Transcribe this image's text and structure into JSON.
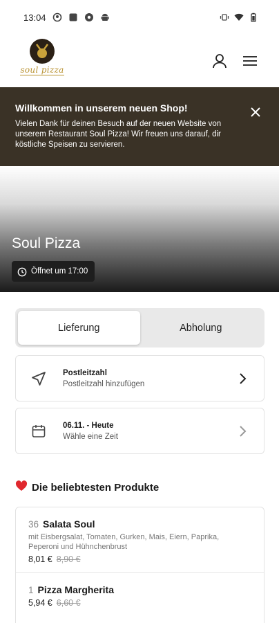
{
  "status_bar": {
    "time": "13:04"
  },
  "logo": {
    "text": "soul pizza"
  },
  "banner": {
    "title": "Willkommen in unserem neuen Shop!",
    "text": "Vielen Dank für deinen Besuch auf der neuen Website von unserem Restaurant Soul Pizza! Wir freuen uns darauf, dir köstliche Speisen zu servieren."
  },
  "hero": {
    "title": "Soul Pizza",
    "badge": "Öffnet um 17:00"
  },
  "delivery_toggle": {
    "options": [
      "Lieferung",
      "Abholung"
    ],
    "selected": "Lieferung"
  },
  "postcode_card": {
    "title": "Postleitzahl",
    "subtitle": "Postleitzahl hinzufügen"
  },
  "date_card": {
    "title": "06.11. - Heute",
    "subtitle": "Wähle eine Zeit"
  },
  "popular": {
    "title": "Die beliebtesten Produkte",
    "products": [
      {
        "number": "36",
        "name": "Salata Soul",
        "description": "mit Eisbergsalat, Tomaten, Gurken, Mais, Eiern, Paprika, Peperoni und Hühnchenbrust",
        "price": "8,01 €",
        "old_price": "8,90 €"
      },
      {
        "number": "1",
        "name": "Pizza Margherita",
        "description": "",
        "price": "5,94 €",
        "old_price": "6,60 €"
      }
    ]
  },
  "colors": {
    "banner_bg": "#3a3226",
    "logo_gold": "#b8912f",
    "heart": "#e0282e"
  }
}
